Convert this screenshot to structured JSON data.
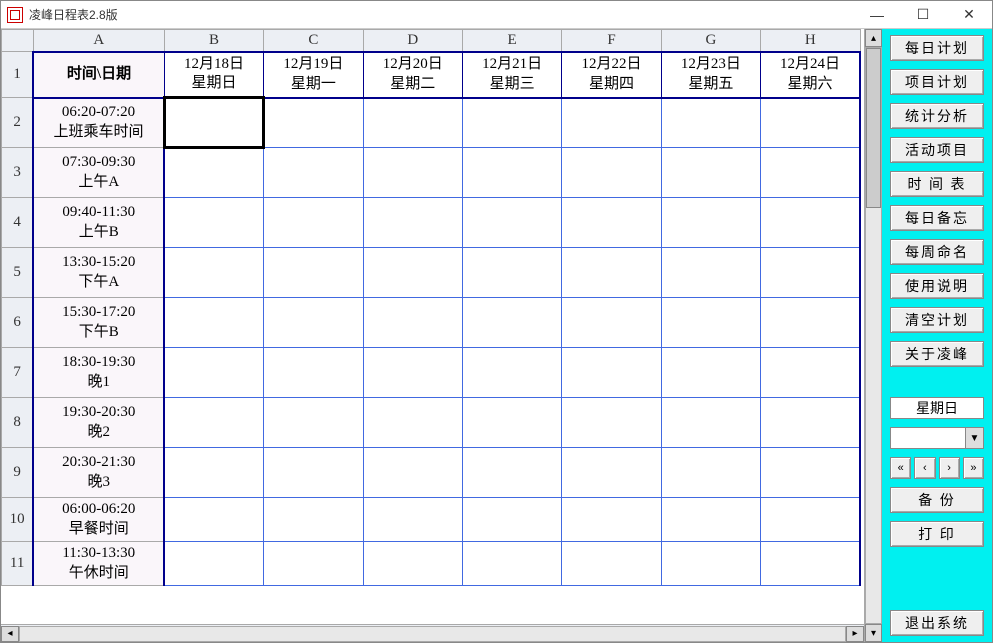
{
  "window": {
    "title": "凌峰日程表2.8版"
  },
  "columns": [
    "A",
    "B",
    "C",
    "D",
    "E",
    "F",
    "G",
    "H"
  ],
  "header_row": {
    "label": "时间\\日期",
    "dates": [
      {
        "d": "12月18日",
        "w": "星期日"
      },
      {
        "d": "12月19日",
        "w": "星期一"
      },
      {
        "d": "12月20日",
        "w": "星期二"
      },
      {
        "d": "12月21日",
        "w": "星期三"
      },
      {
        "d": "12月22日",
        "w": "星期四"
      },
      {
        "d": "12月23日",
        "w": "星期五"
      },
      {
        "d": "12月24日",
        "w": "星期六"
      }
    ]
  },
  "rows": [
    {
      "n": "2",
      "time": "06:20-07:20",
      "label": "上班乘车时间"
    },
    {
      "n": "3",
      "time": "07:30-09:30",
      "label": "上午A"
    },
    {
      "n": "4",
      "time": "09:40-11:30",
      "label": "上午B"
    },
    {
      "n": "5",
      "time": "13:30-15:20",
      "label": "下午A"
    },
    {
      "n": "6",
      "time": "15:30-17:20",
      "label": "下午B"
    },
    {
      "n": "7",
      "time": "18:30-19:30",
      "label": "晚1"
    },
    {
      "n": "8",
      "time": "19:30-20:30",
      "label": "晚2"
    },
    {
      "n": "9",
      "time": "20:30-21:30",
      "label": "晚3"
    },
    {
      "n": "10",
      "time": "06:00-06:20",
      "label": "早餐时间"
    },
    {
      "n": "11",
      "time": "11:30-13:30",
      "label": "午休时间"
    }
  ],
  "selected_cell": {
    "row": 0,
    "col": 0
  },
  "sidebar": {
    "buttons_top": [
      "每日计划",
      "项目计划",
      "统计分析",
      "活动项目",
      "时 间 表",
      "每日备忘",
      "每周命名",
      "使用说明",
      "清空计划",
      "关于凌峰"
    ],
    "weekday": "星期日",
    "combo_value": "",
    "nav": [
      "«",
      "‹",
      "›",
      "»"
    ],
    "buttons_mid": [
      "备 份",
      "打 印"
    ],
    "exit": "退出系统"
  }
}
